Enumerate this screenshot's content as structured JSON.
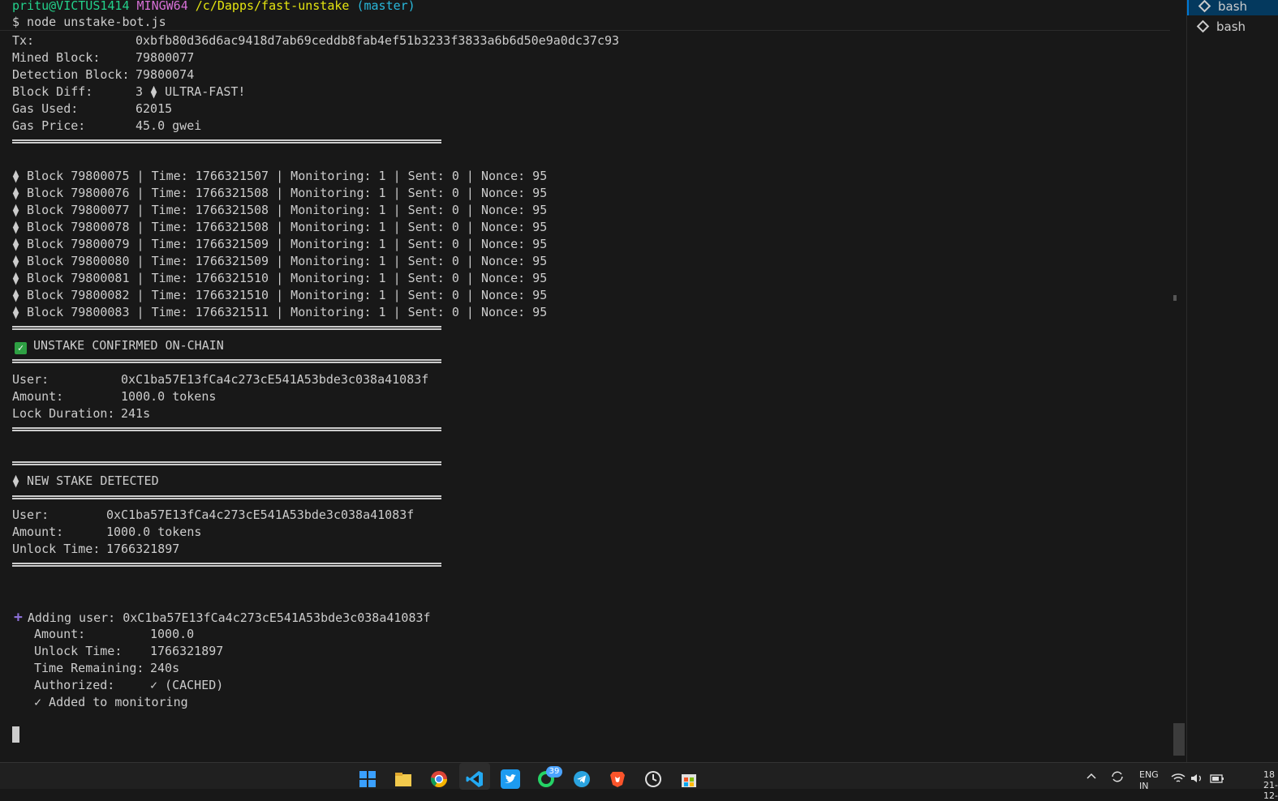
{
  "prompt": {
    "user_host": "pritu@VICTUS1414",
    "env": "MINGW64",
    "path": "/c/Dapps/fast-unstake",
    "branch": "(master)",
    "command": "$ node unstake-bot.js"
  },
  "tx_info": [
    {
      "label": "Tx:",
      "value": "0xbfb80d36d6ac9418d7ab69ceddb8fab4ef51b3233f3833a6b6d50e9a0dc37c93"
    },
    {
      "label": "Mined Block:",
      "value": "79800077"
    },
    {
      "label": "Detection Block:",
      "value": "79800074"
    },
    {
      "label": "Block Diff:",
      "value": "3 ⧫ ULTRA-FAST!"
    },
    {
      "label": "Gas Used:",
      "value": "62015"
    },
    {
      "label": "Gas Price:",
      "value": "45.0 gwei"
    }
  ],
  "block_lines": [
    "⧫ Block 79800075 | Time: 1766321507 | Monitoring: 1 | Sent: 0 | Nonce: 95",
    "⧫ Block 79800076 | Time: 1766321508 | Monitoring: 1 | Sent: 0 | Nonce: 95",
    "⧫ Block 79800077 | Time: 1766321508 | Monitoring: 1 | Sent: 0 | Nonce: 95",
    "⧫ Block 79800078 | Time: 1766321508 | Monitoring: 1 | Sent: 0 | Nonce: 95",
    "⧫ Block 79800079 | Time: 1766321509 | Monitoring: 1 | Sent: 0 | Nonce: 95",
    "⧫ Block 79800080 | Time: 1766321509 | Monitoring: 1 | Sent: 0 | Nonce: 95",
    "⧫ Block 79800081 | Time: 1766321510 | Monitoring: 1 | Sent: 0 | Nonce: 95",
    "⧫ Block 79800082 | Time: 1766321510 | Monitoring: 1 | Sent: 0 | Nonce: 95",
    "⧫ Block 79800083 | Time: 1766321511 | Monitoring: 1 | Sent: 0 | Nonce: 95"
  ],
  "unstake": {
    "title": "UNSTAKE CONFIRMED ON-CHAIN",
    "check_icon": "✓",
    "rows": [
      {
        "label": "User:",
        "value": "0xC1ba57E13fCa4c273cE541A53bde3c038a41083f"
      },
      {
        "label": "Amount:",
        "value": "1000.0 tokens"
      },
      {
        "label": "Lock Duration:",
        "value": "241s"
      }
    ]
  },
  "new_stake": {
    "title": "⧫ NEW STAKE DETECTED",
    "rows": [
      {
        "label": "User:",
        "value": "0xC1ba57E13fCa4c273cE541A53bde3c038a41083f"
      },
      {
        "label": "Amount:",
        "value": "1000.0 tokens"
      },
      {
        "label": "Unlock Time:",
        "value": "1766321897"
      }
    ]
  },
  "adding_user": {
    "plus_icon": "+",
    "title": "Adding user: 0xC1ba57E13fCa4c273cE541A53bde3c038a41083f",
    "rows": [
      {
        "label": "Amount:",
        "value": "1000.0"
      },
      {
        "label": "Unlock Time:",
        "value": "1766321897"
      },
      {
        "label": "Time Remaining:",
        "value": "240s"
      },
      {
        "label": "Authorized:",
        "value": "✓ (CACHED)"
      }
    ],
    "done": "✓ Added to monitoring"
  },
  "terminals": [
    {
      "label": "bash",
      "active": true
    },
    {
      "label": "bash",
      "active": false
    }
  ],
  "taskbar": {
    "whatsapp_badge": "39",
    "lang": "ENG",
    "lang_sub": "IN",
    "clock_partial": "18",
    "date_partial": "21-12-"
  },
  "colors": {
    "background": "#181818",
    "prompt_user": "#23d18b",
    "prompt_env": "#d670d6",
    "prompt_path": "#e5e510",
    "prompt_branch": "#29b8db",
    "check_green": "#2ea043",
    "plus_purple": "#8b6fd6"
  }
}
